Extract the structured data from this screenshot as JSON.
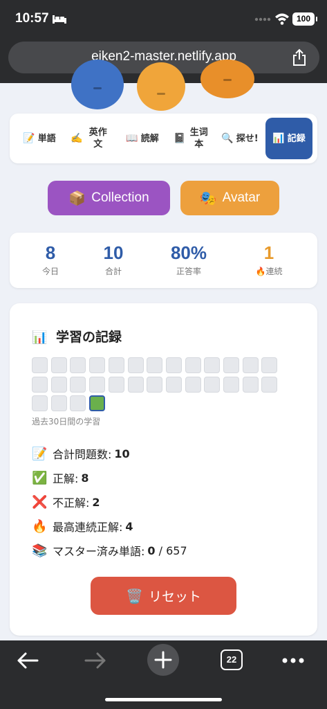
{
  "status_bar": {
    "time": "10:57",
    "battery": "100"
  },
  "browser": {
    "url": "eiken2-master.netlify.app",
    "tab_count": "22"
  },
  "nav": {
    "tabs": [
      {
        "icon": "📝",
        "label": "単語"
      },
      {
        "icon": "✍️",
        "label": "英作文"
      },
      {
        "icon": "📖",
        "label": "読解"
      },
      {
        "icon": "📓",
        "label": "生词本"
      },
      {
        "icon": "🔍",
        "label": "探せ!"
      },
      {
        "icon": "📊",
        "label": "記録"
      }
    ],
    "active_tab": "記録"
  },
  "buttons": {
    "collection": {
      "icon": "📦",
      "label": "Collection"
    },
    "avatar": {
      "icon": "🎭",
      "label": "Avatar"
    }
  },
  "stats": [
    {
      "value": "8",
      "label": "今日"
    },
    {
      "value": "10",
      "label": "合計"
    },
    {
      "value": "80%",
      "label": "正答率"
    },
    {
      "value": "1",
      "label": "🔥連続"
    }
  ],
  "record": {
    "title_icon": "📊",
    "title": "学習の記録",
    "heatmap": {
      "days": 30,
      "active_days": [
        30
      ],
      "caption": "過去30日間の学習"
    },
    "lines": [
      {
        "icon": "📝",
        "label": "合計問題数:",
        "value": "10",
        "suffix": ""
      },
      {
        "icon": "✅",
        "label": "正解:",
        "value": "8",
        "suffix": ""
      },
      {
        "icon": "❌",
        "label": "不正解:",
        "value": "2",
        "suffix": ""
      },
      {
        "icon": "🔥",
        "label": "最高連続正解:",
        "value": "4",
        "suffix": ""
      },
      {
        "icon": "📚",
        "label": "マスター済み単語:",
        "value": "0",
        "suffix": " / 657"
      }
    ],
    "reset": {
      "icon": "🗑️",
      "label": "リセット"
    }
  },
  "colors": {
    "primary": "#2f5ca8",
    "purple": "#9b54c2",
    "orange": "#eda03d",
    "danger": "#dc5642",
    "heat_active": "#6ab04c"
  }
}
